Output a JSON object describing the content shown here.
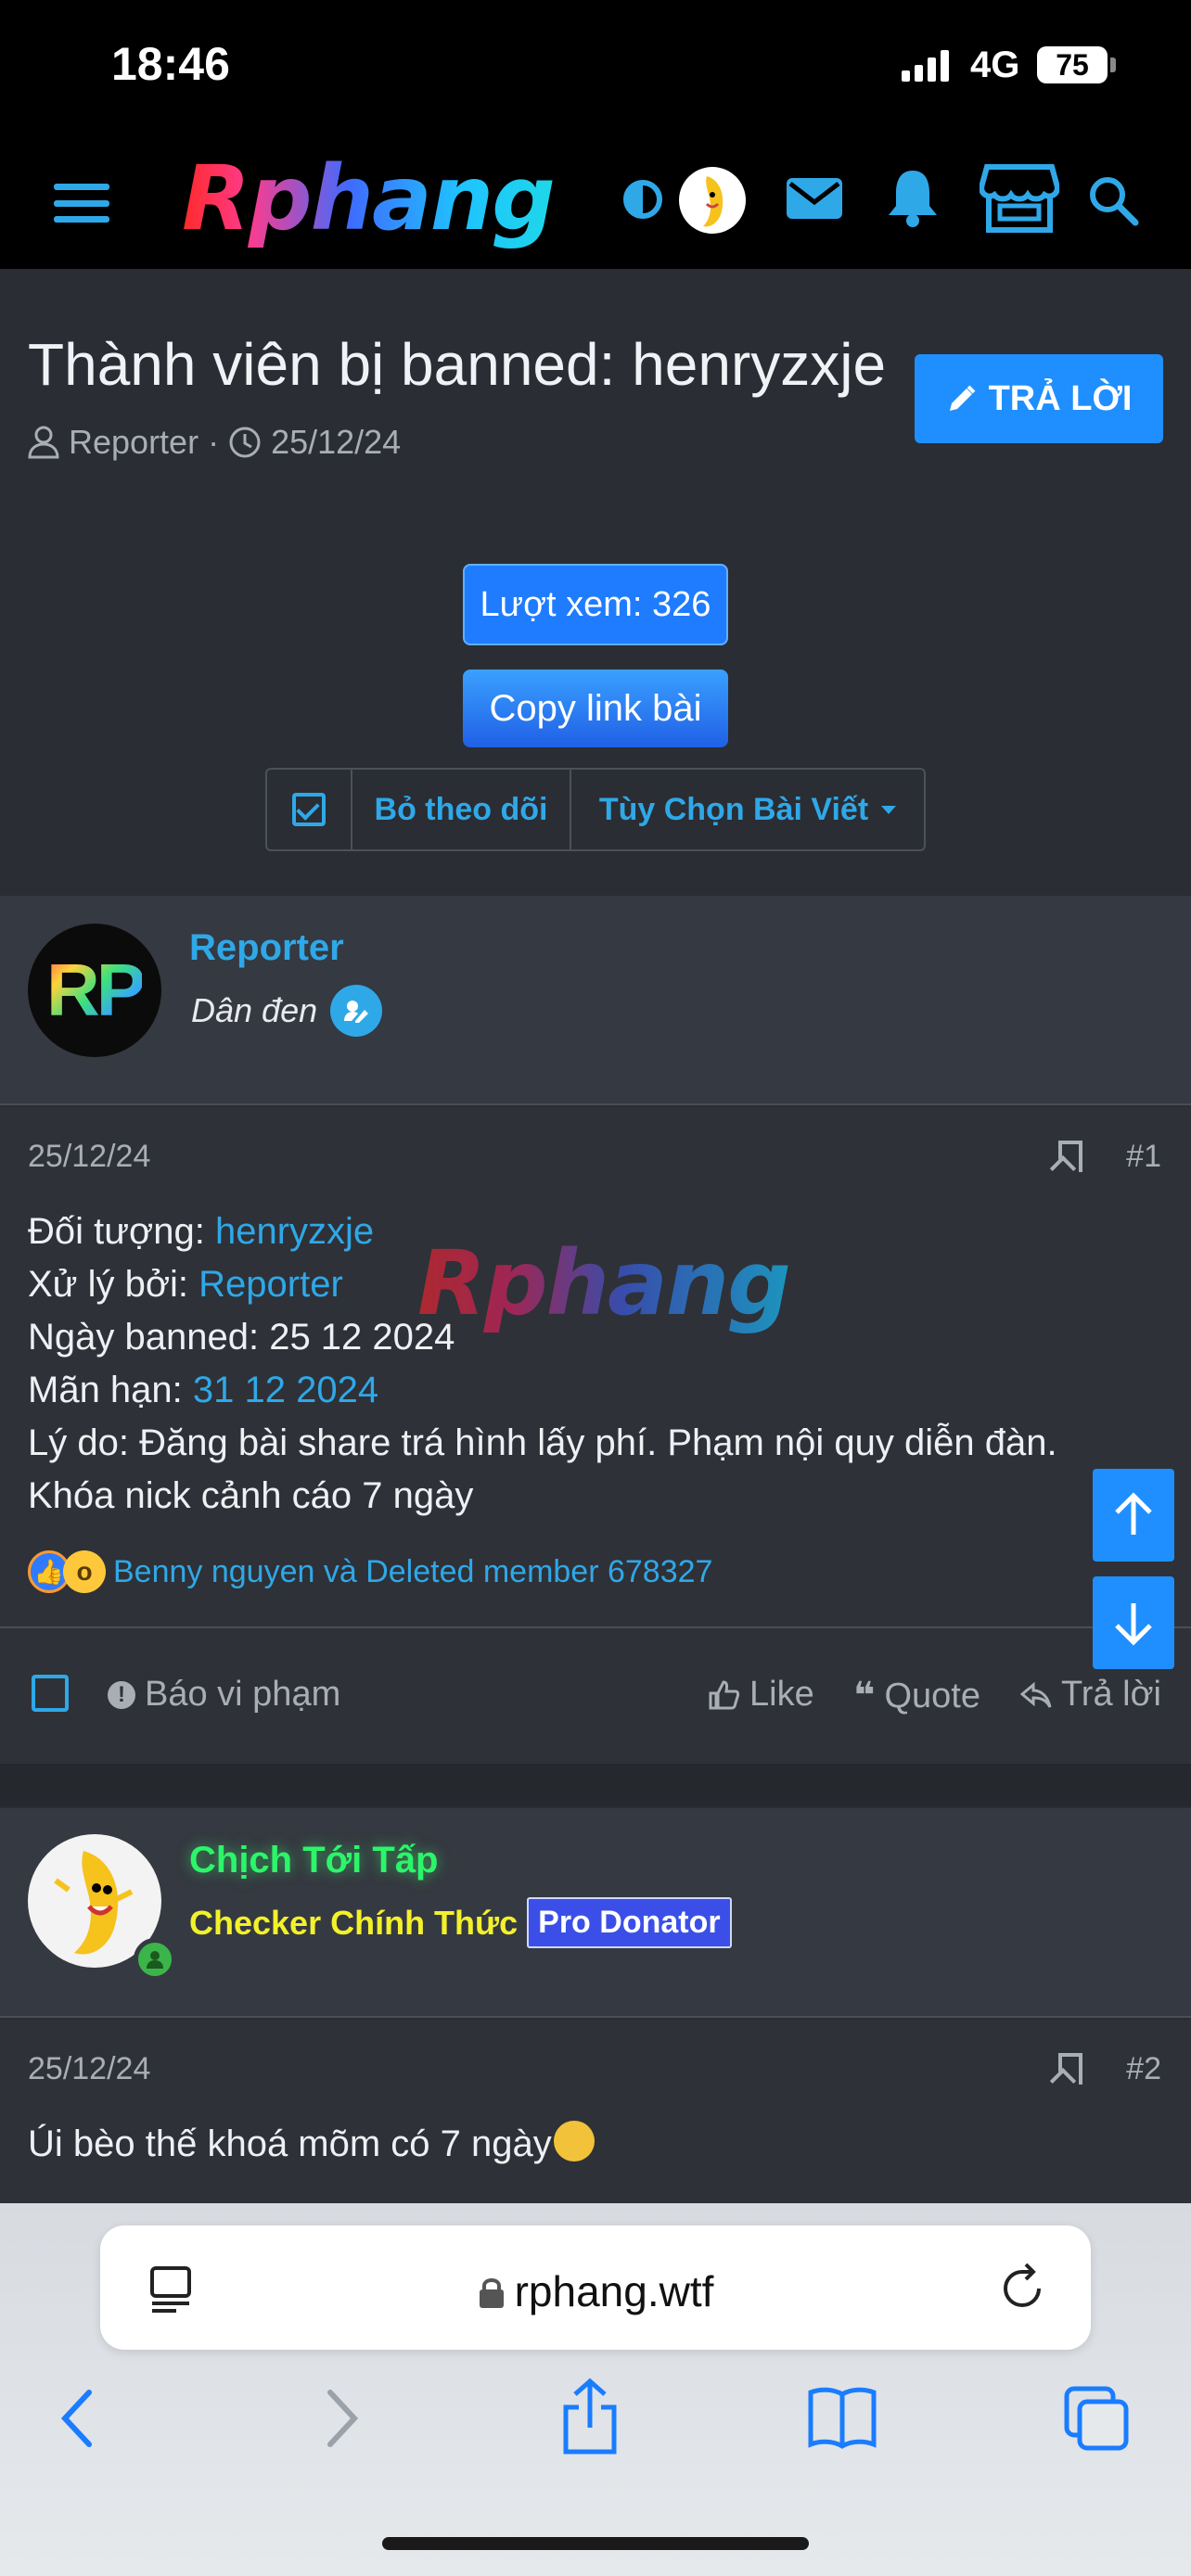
{
  "status_bar": {
    "time": "18:46",
    "network": "4G",
    "battery": "75"
  },
  "header": {
    "logo": "Rphang",
    "icons": [
      "menu-icon",
      "theme-toggle-icon",
      "avatar",
      "mail-icon",
      "bell-icon",
      "store-icon",
      "search-icon"
    ]
  },
  "thread": {
    "title": "Thành viên bị banned: henryzxje",
    "author": "Reporter",
    "separator": "·",
    "date": "25/12/24",
    "reply_label": "TRẢ LỜI",
    "views_label": "Lượt xem: 326",
    "copy_label": "Copy link bài",
    "unfollow_label": "Bỏ theo dõi",
    "options_label": "Tùy Chọn Bài Viết"
  },
  "post1": {
    "username": "Reporter",
    "user_title": "Dân đen",
    "date": "25/12/24",
    "number": "#1",
    "watermark": "Rphang",
    "lines": {
      "l1_label": "Đối tượng: ",
      "l1_value": "henryzxje",
      "l2_label": "Xử lý bởi: ",
      "l2_value": "Reporter",
      "l3": "Ngày banned: 25 12 2024",
      "l4_label": "Mãn hạn: ",
      "l4_value": "31 12 2024",
      "l5": "Lý do: Đăng bài share trá hình lấy phí. Phạm nội quy diễn đàn.",
      "l6": "Khóa nick cảnh cáo 7 ngày"
    },
    "reactions_text": "Benny nguyen và Deleted member 678327",
    "report_label": "Báo vi phạm",
    "like_label": "Like",
    "quote_label": "Quote",
    "reply_label": "Trả lời"
  },
  "post2": {
    "username": "Chịch Tới Tấp",
    "user_title": "Checker Chính Thức",
    "badge": "Pro Donator",
    "date": "25/12/24",
    "number": "#2",
    "content": "Úi bèo thế khoá mõm có 7 ngày"
  },
  "browser": {
    "url": "rphang.wtf"
  },
  "colors": {
    "accent": "#2fa8e8",
    "button": "#1f8fff",
    "background": "#2a2d33",
    "green_name": "#2cf56a",
    "yellow_title": "#f3f12a"
  }
}
